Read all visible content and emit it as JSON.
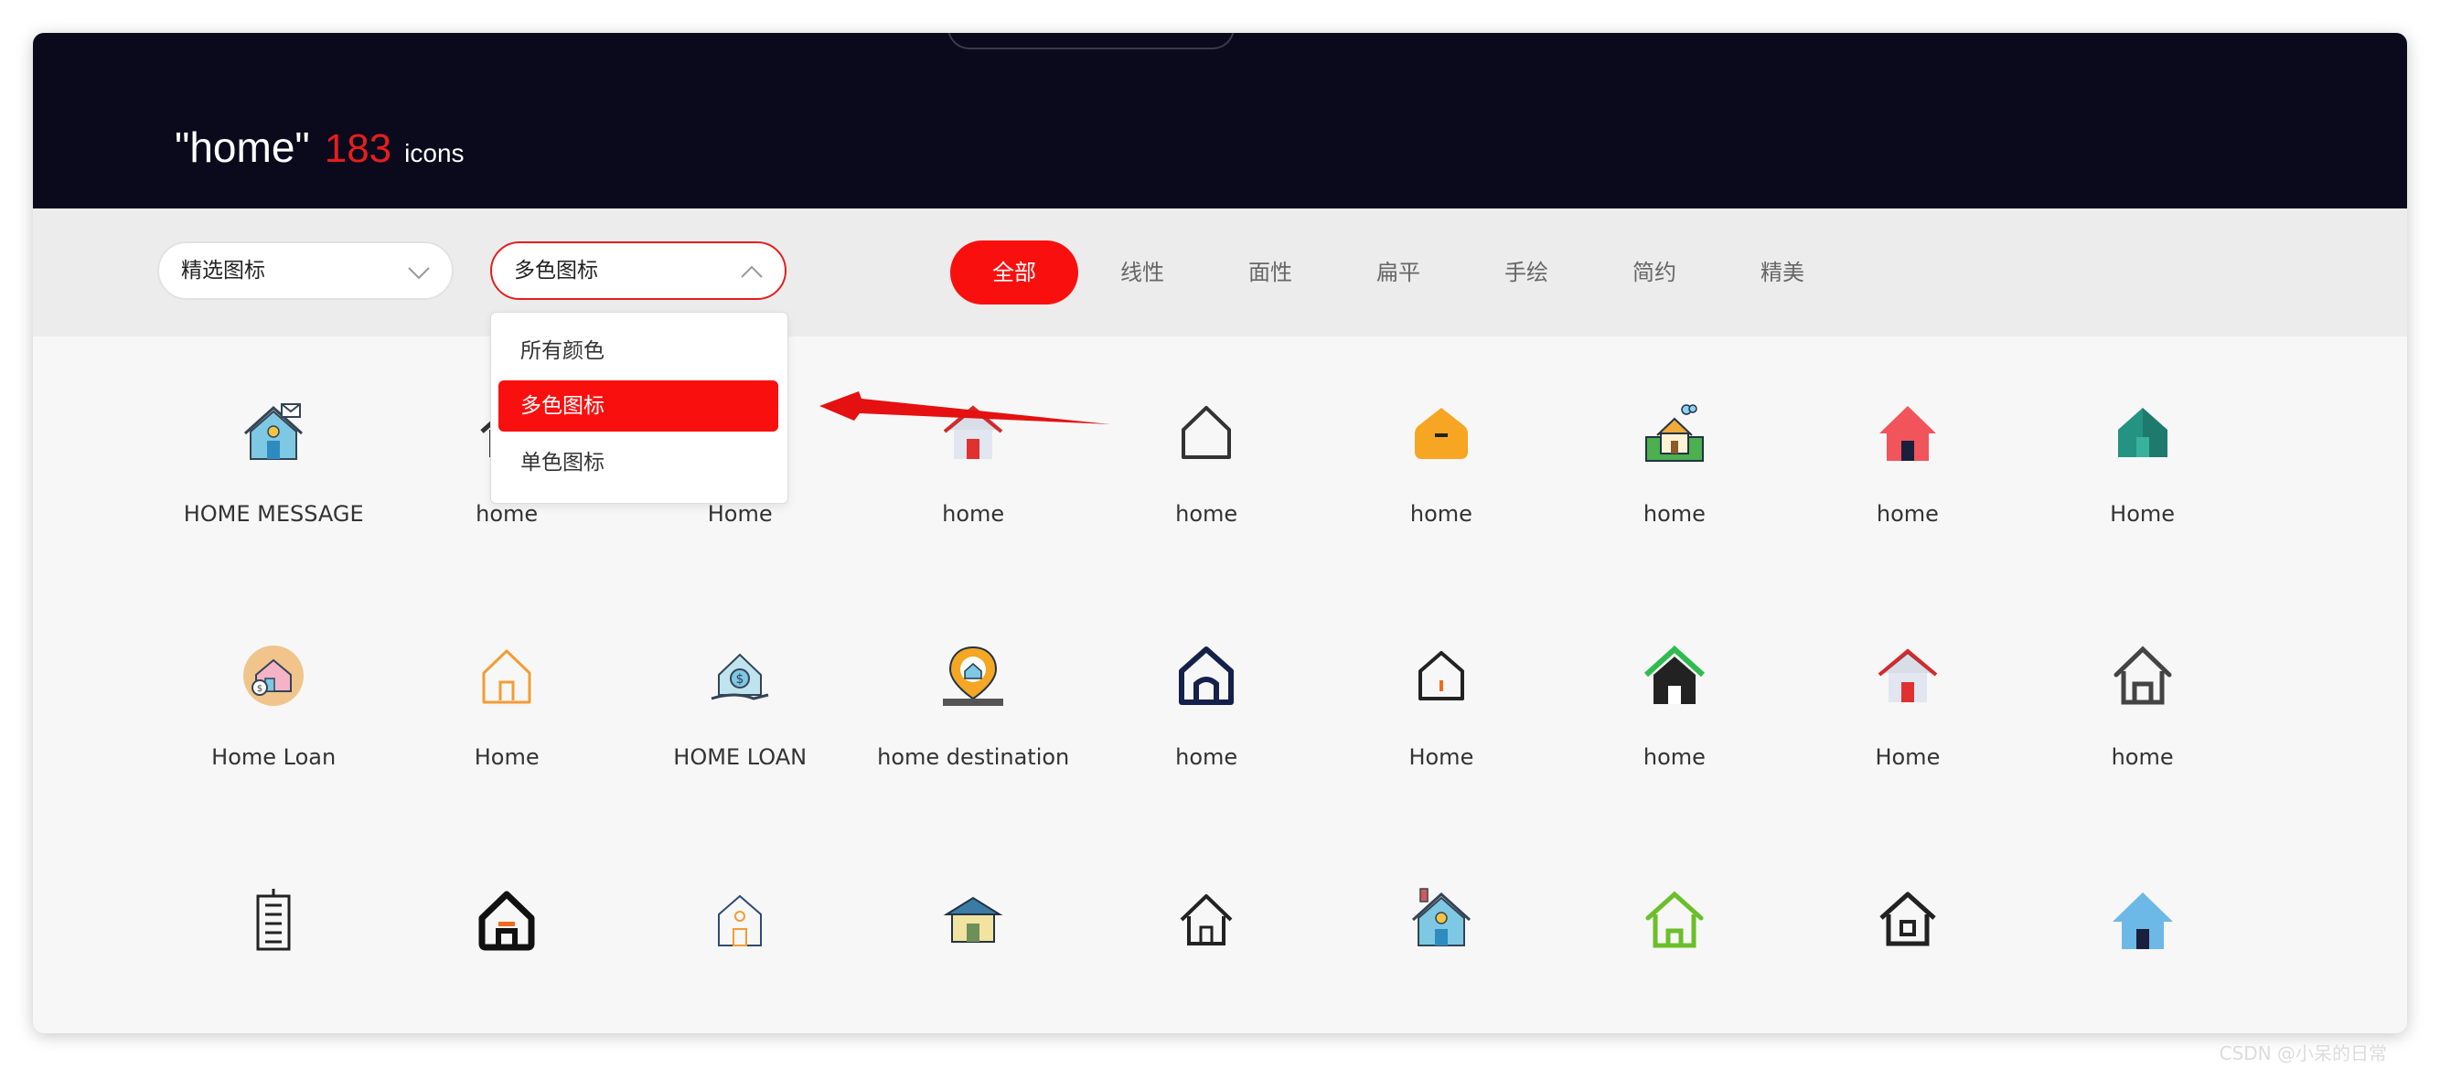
{
  "header": {
    "query": "\"home\"",
    "count": "183",
    "unit": "icons"
  },
  "filters": {
    "source_select": "精选图标",
    "color_select": "多色图标",
    "color_options": [
      "所有颜色",
      "多色图标",
      "单色图标"
    ],
    "selected_option": "多色图标",
    "style_tabs": [
      "全部",
      "线性",
      "面性",
      "扁平",
      "手绘",
      "简约",
      "精美"
    ],
    "active_tab": "全部"
  },
  "colors": {
    "header_bg": "#0b0a1c",
    "accent": "#fa0f0f",
    "count": "#e51e1e",
    "panel": "#f7f7f7"
  },
  "icons": [
    [
      {
        "label": "HOME MESSAGE",
        "icon": "home-message-icon"
      },
      {
        "label": "home",
        "icon": "home-icon"
      },
      {
        "label": "Home",
        "icon": "home-icon"
      },
      {
        "label": "home",
        "icon": "home-red-door-icon"
      },
      {
        "label": "home",
        "icon": "home-outline-icon"
      },
      {
        "label": "home",
        "icon": "home-orange-icon"
      },
      {
        "label": "home",
        "icon": "home-scene-icon"
      },
      {
        "label": "home",
        "icon": "home-red-icon"
      },
      {
        "label": "Home",
        "icon": "home-teal-icon"
      }
    ],
    [
      {
        "label": "Home Loan",
        "icon": "home-loan-icon"
      },
      {
        "label": "Home",
        "icon": "home-orange-outline-icon"
      },
      {
        "label": "HOME LOAN",
        "icon": "home-loan-dollar-icon"
      },
      {
        "label": "home destination",
        "icon": "home-pin-icon"
      },
      {
        "label": "home",
        "icon": "home-navy-icon"
      },
      {
        "label": "Home",
        "icon": "home-pentagon-icon"
      },
      {
        "label": "home",
        "icon": "home-green-roof-icon"
      },
      {
        "label": "Home",
        "icon": "home-red-door-icon"
      },
      {
        "label": "home",
        "icon": "home-gray-outline-icon"
      }
    ],
    [
      {
        "label": "",
        "icon": "building-icon"
      },
      {
        "label": "",
        "icon": "home-bold-icon"
      },
      {
        "label": "",
        "icon": "home-line-icon"
      },
      {
        "label": "",
        "icon": "home-shop-icon"
      },
      {
        "label": "",
        "icon": "home-thin-icon"
      },
      {
        "label": "",
        "icon": "home-blue-icon"
      },
      {
        "label": "",
        "icon": "home-green-outline-icon"
      },
      {
        "label": "",
        "icon": "home-square-icon"
      },
      {
        "label": "",
        "icon": "home-blue-flat-icon"
      }
    ]
  ],
  "watermark": "CSDN @小呆的日常"
}
